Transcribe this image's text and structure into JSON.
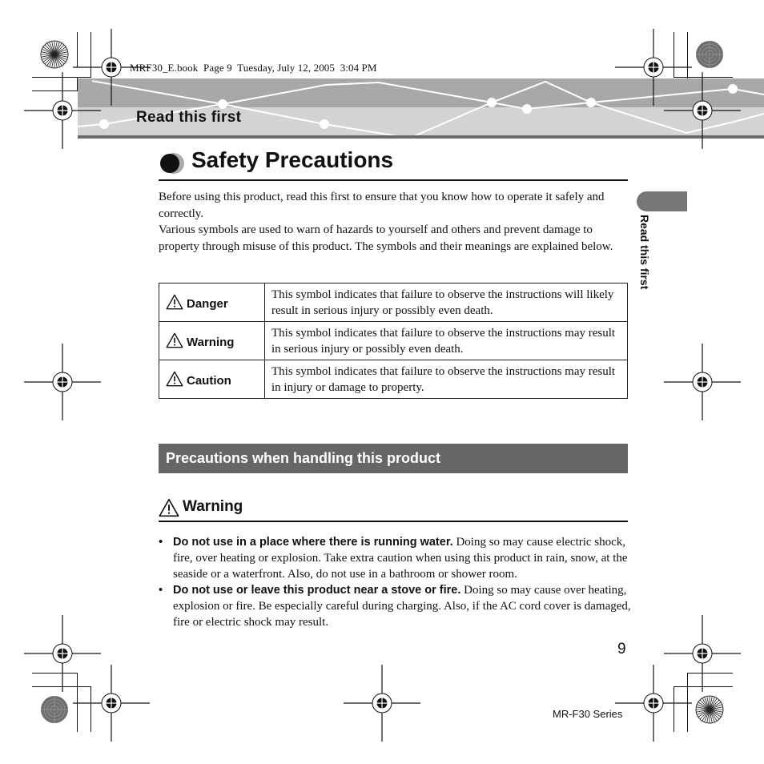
{
  "print_info": "MRF30_E.book  Page 9  Tuesday, July 12, 2005  3:04 PM",
  "header": {
    "section_title": "Read this first",
    "colors": {
      "band_dark": "#a7a8aa",
      "band_light": "#d2d3d4",
      "band_rule": "#6b6b6b"
    }
  },
  "side_tab": {
    "label": "Read this first",
    "color": "#777777"
  },
  "title": {
    "icon": "circle-bullet-icon",
    "text": "Safety Precautions"
  },
  "intro": {
    "paragraphs": [
      "Before using this product, read this first to ensure that you know how to operate it safely and correctly.",
      "Various symbols are used to warn of hazards to yourself and others and prevent damage to property through misuse of this product. The symbols and their meanings are explained below."
    ]
  },
  "symbols_table": {
    "rows": [
      {
        "icon": "warning-triangle-icon",
        "label": "Danger",
        "description": "This symbol indicates that failure to observe the instructions will likely result in serious injury or possibly even death."
      },
      {
        "icon": "warning-triangle-icon",
        "label": "Warning",
        "description": "This symbol indicates that failure to observe the instructions may result in serious injury or possibly even death."
      },
      {
        "icon": "warning-triangle-icon",
        "label": "Caution",
        "description": "This symbol indicates that failure to observe the instructions may result in injury or damage to property."
      }
    ]
  },
  "section": {
    "title": "Precautions when handling this product",
    "color": "#666666"
  },
  "warning_block": {
    "icon": "warning-triangle-icon",
    "heading": "Warning",
    "items": [
      {
        "bold": "Do not use in a place where there is running water.",
        "text": " Doing so may cause electric shock, fire, over heating or explosion. Take extra caution when using this product in rain, snow, at the seaside or a waterfront. Also, do not use in a bathroom or shower room."
      },
      {
        "bold": "Do not use or leave this product near a stove or fire.",
        "text": " Doing so may cause over heating, explosion or fire. Be especially careful during charging. Also, if the AC cord cover is damaged, fire or electric shock may result."
      }
    ]
  },
  "footer": {
    "page_number": "9",
    "series": "MR-F30 Series"
  }
}
